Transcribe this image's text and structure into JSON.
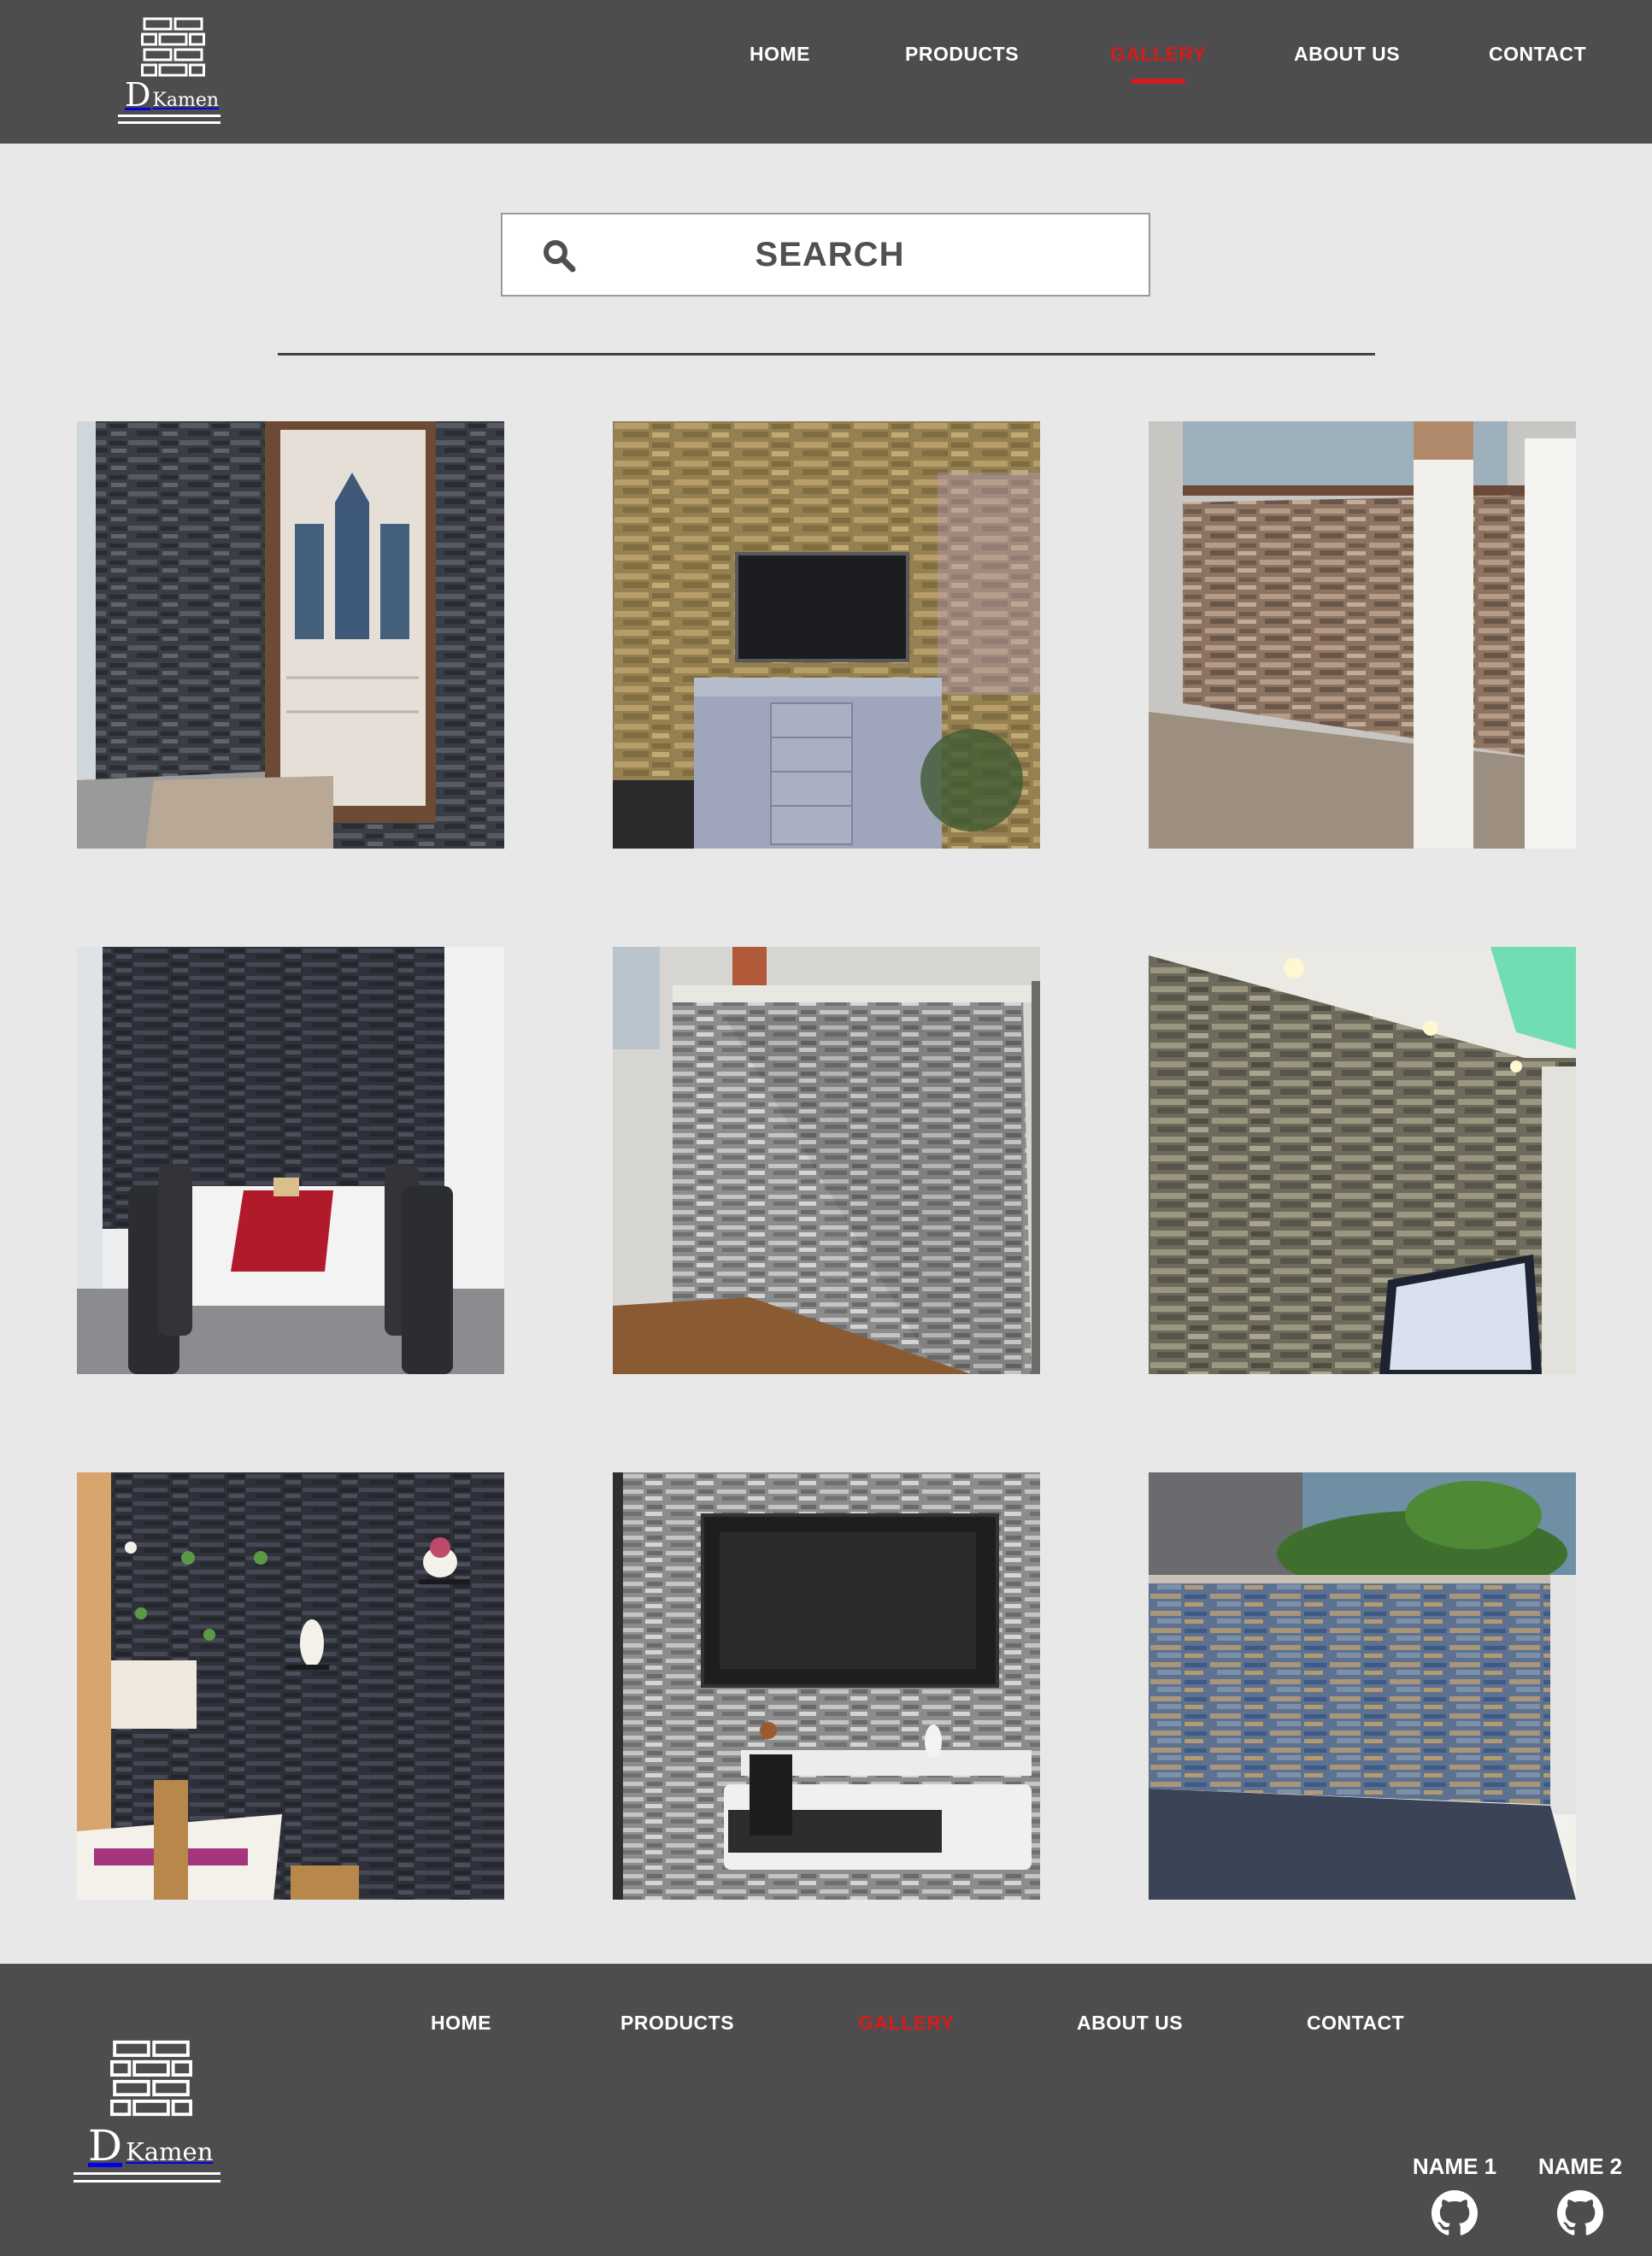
{
  "brand": {
    "logo_big": "D",
    "logo_small": "Kamen"
  },
  "nav": {
    "items": [
      {
        "label": "HOME",
        "active": false
      },
      {
        "label": "PRODUCTS",
        "active": false
      },
      {
        "label": "GALLERY",
        "active": true
      },
      {
        "label": "ABOUT US",
        "active": false
      },
      {
        "label": "CONTACT",
        "active": false
      }
    ]
  },
  "search": {
    "label": "SEARCH",
    "icon": "search-icon"
  },
  "gallery": {
    "images": [
      {
        "subject": "doorway with dark stone wall cladding"
      },
      {
        "subject": "TV cabinet in front of beige stone wall"
      },
      {
        "subject": "balcony wall with brown stone cladding"
      },
      {
        "subject": "dining table against dark stone wall"
      },
      {
        "subject": "kitchen counter with grey stone cladding"
      },
      {
        "subject": "beige stone feature wall with green ceiling light"
      },
      {
        "subject": "restaurant wall in dark slate with plant shelves"
      },
      {
        "subject": "mounted TV on grey stone wall"
      },
      {
        "subject": "outdoor wall with blue and tan stone cladding"
      }
    ]
  },
  "footer": {
    "credits": [
      {
        "name": "NAME 1",
        "icon": "github-icon"
      },
      {
        "name": "NAME 2",
        "icon": "github-icon"
      }
    ]
  },
  "colors": {
    "bar": "#4d4d4f",
    "page": "#e8e8e8",
    "accent": "#d51c1c",
    "text_light": "#ffffff"
  }
}
